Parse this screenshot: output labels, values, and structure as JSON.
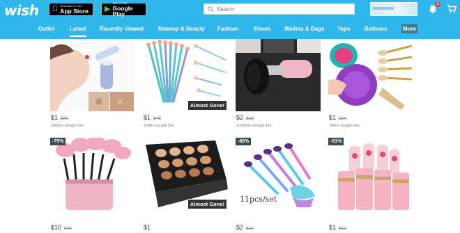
{
  "header": {
    "logo": "wish",
    "app_store": {
      "small": "Download on the",
      "big": "App Store"
    },
    "google_play": {
      "small": "GET IT ON",
      "big": "Google Play"
    },
    "search_placeholder": "Search",
    "notification_count": "1"
  },
  "nav": [
    "Outlet",
    "Latest",
    "Recently Viewed",
    "Makeup & Beauty",
    "Fashion",
    "Shoes",
    "Wallets & Bags",
    "Tops",
    "Bottoms",
    "More"
  ],
  "active_nav": "Latest",
  "products": [
    {
      "price": "$1",
      "old": "$30",
      "bought": "20000+ bought this"
    },
    {
      "price": "$1",
      "old": "$45",
      "bought": "1000+ bought this",
      "badge": "Almost Gone!"
    },
    {
      "price": "$2",
      "old": "$16",
      "bought": "100000+ bought this"
    },
    {
      "price": "$1",
      "old": "$14",
      "bought": "1000+ bought this"
    },
    {
      "price": "$10",
      "old": "$40",
      "discount": "-75%"
    },
    {
      "price": "$1",
      "old": "",
      "badge": "Almost Gone!"
    },
    {
      "price": "$2",
      "old": "$10",
      "discount": "-80%",
      "image_text": "11pcs/set"
    },
    {
      "price": "$1",
      "old": "$12",
      "discount": "-91%"
    }
  ],
  "colors": {
    "header": "#2fb7ec",
    "more": "#3c7a92",
    "badge": "#333333"
  }
}
